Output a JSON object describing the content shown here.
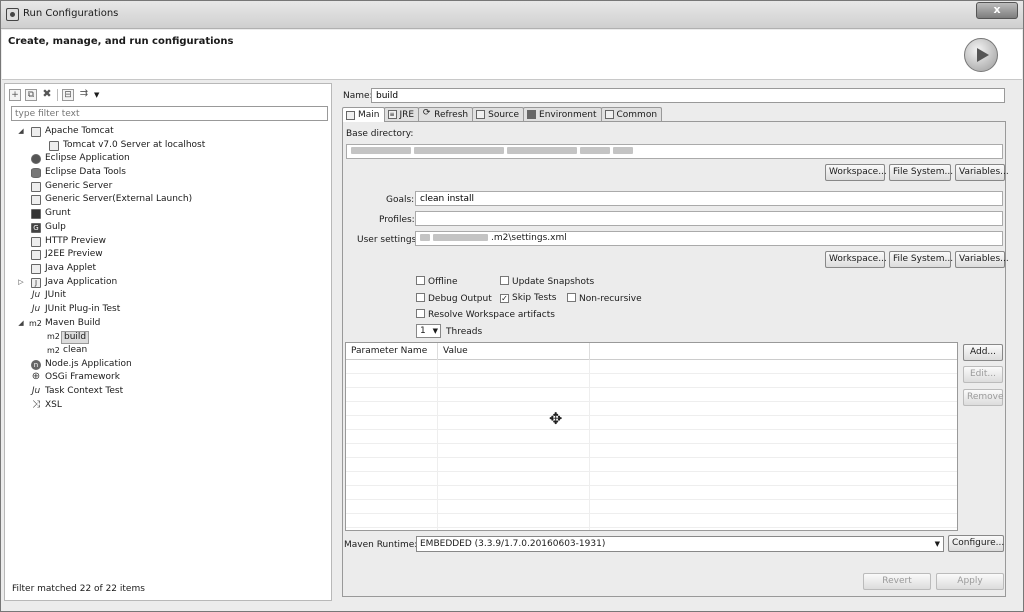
{
  "window": {
    "title": "Run Configurations",
    "close": "x"
  },
  "header": {
    "title": "Create, manage, and run configurations"
  },
  "filter": {
    "placeholder": "type filter text"
  },
  "tree": [
    {
      "label": "Apache Tomcat",
      "level": 0,
      "expanded": true,
      "icon": "page-icon"
    },
    {
      "label": "Tomcat v7.0 Server at localhost",
      "level": 1,
      "icon": "page-icon"
    },
    {
      "label": "Eclipse Application",
      "level": 0,
      "icon": "eclipse-icon"
    },
    {
      "label": "Eclipse Data Tools",
      "level": 0,
      "icon": "database-icon"
    },
    {
      "label": "Generic Server",
      "level": 0,
      "icon": "page-icon"
    },
    {
      "label": "Generic Server(External Launch)",
      "level": 0,
      "icon": "page-icon"
    },
    {
      "label": "Grunt",
      "level": 0,
      "icon": "grunt-icon"
    },
    {
      "label": "Gulp",
      "level": 0,
      "icon": "gulp-icon"
    },
    {
      "label": "HTTP Preview",
      "level": 0,
      "icon": "page-icon"
    },
    {
      "label": "J2EE Preview",
      "level": 0,
      "icon": "page-icon"
    },
    {
      "label": "Java Applet",
      "level": 0,
      "icon": "applet-icon"
    },
    {
      "label": "Java Application",
      "level": 0,
      "collapsed": true,
      "icon": "java-app-icon"
    },
    {
      "label": "JUnit",
      "level": 0,
      "icon": "junit-icon"
    },
    {
      "label": "JUnit Plug-in Test",
      "level": 0,
      "icon": "junit-plugin-icon"
    },
    {
      "label": "Maven Build",
      "level": 0,
      "expanded": true,
      "icon": "m2-icon",
      "prefix": "m2"
    },
    {
      "label": "build",
      "level": 1,
      "selected": true,
      "icon": "m2-icon",
      "prefix": "m2"
    },
    {
      "label": "clean",
      "level": 1,
      "icon": "m2-icon",
      "prefix": "m2"
    },
    {
      "label": "Node.js Application",
      "level": 0,
      "icon": "nodejs-icon"
    },
    {
      "label": "OSGi Framework",
      "level": 0,
      "icon": "osgi-icon"
    },
    {
      "label": "Task Context Test",
      "level": 0,
      "icon": "task-icon"
    },
    {
      "label": "XSL",
      "level": 0,
      "icon": "xsl-icon"
    }
  ],
  "status": "Filter matched 22 of 22 items",
  "config": {
    "name_label": "Name:",
    "name_value": "build",
    "tabs": [
      "Main",
      "JRE",
      "Refresh",
      "Source",
      "Environment",
      "Common"
    ],
    "base_dir_label": "Base directory:",
    "workspace_btn": "Workspace...",
    "filesystem_btn": "File System...",
    "variables_btn": "Variables...",
    "goals_label": "Goals:",
    "goals_value": "clean install",
    "profiles_label": "Profiles:",
    "user_settings_label": "User settings:",
    "user_settings_value": ".m2\\settings.xml",
    "offline": "Offline",
    "update_snapshots": "Update Snapshots",
    "debug_output": "Debug Output",
    "skip_tests": "Skip Tests",
    "non_recursive": "Non-recursive",
    "resolve_workspace": "Resolve Workspace artifacts",
    "threads_value": "1",
    "threads_label": "Threads",
    "col_param_name": "Parameter Name",
    "col_value": "Value",
    "add_btn": "Add...",
    "edit_btn": "Edit...",
    "remove_btn": "Remove",
    "runtime_label": "Maven Runtime:",
    "runtime_value": "EMBEDDED (3.3.9/1.7.0.20160603-1931)",
    "configure_btn": "Configure..."
  },
  "footer": {
    "revert": "Revert",
    "apply": "Apply"
  }
}
